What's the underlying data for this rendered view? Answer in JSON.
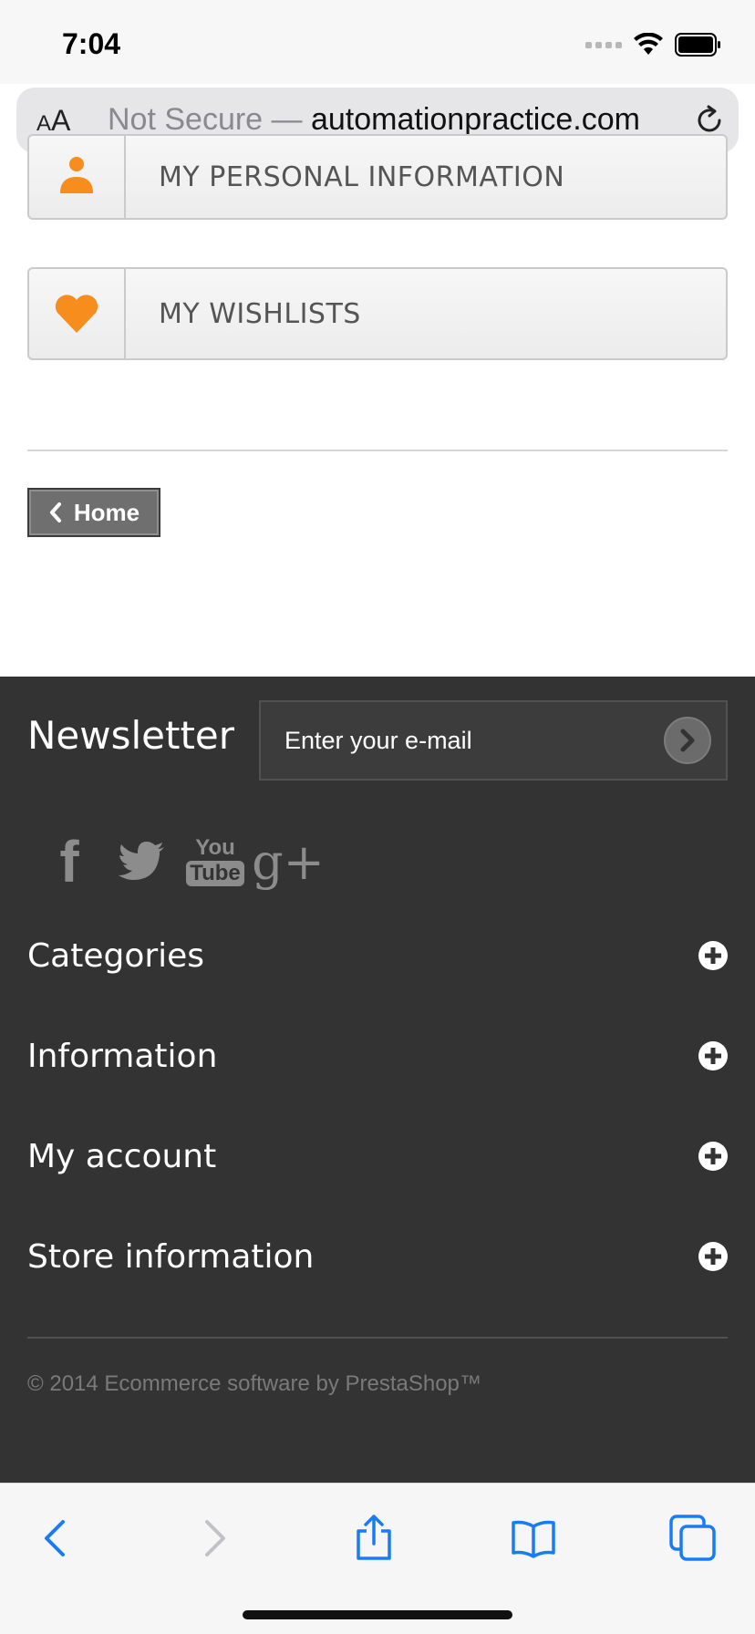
{
  "status_bar": {
    "time": "7:04",
    "icons": [
      "cellular-signal-icon",
      "wifi-icon",
      "battery-icon"
    ]
  },
  "safari": {
    "text_size_label_small": "A",
    "text_size_label_big": "A",
    "security_label": "Not Secure — ",
    "domain": "automationpractice.com",
    "reload_icon": "reload-icon"
  },
  "account_links": {
    "personal_info": {
      "label": "MY PERSONAL INFORMATION",
      "icon": "user-icon"
    },
    "wishlists": {
      "label": "MY WISHLISTS",
      "icon": "heart-icon"
    }
  },
  "home_button": {
    "label": "Home",
    "icon": "chevron-left-icon"
  },
  "footer": {
    "newsletter": {
      "title": "Newsletter",
      "placeholder": "Enter your e-mail",
      "submit_icon": "chevron-right-icon"
    },
    "social": [
      {
        "name": "facebook",
        "glyph": "f"
      },
      {
        "name": "twitter",
        "glyph": ""
      },
      {
        "name": "youtube",
        "glyph_top": "You",
        "glyph_bottom": "Tube"
      },
      {
        "name": "google-plus",
        "glyph": "g+"
      }
    ],
    "sections": [
      {
        "title": "Categories"
      },
      {
        "title": "Information"
      },
      {
        "title": "My account"
      },
      {
        "title": "Store information"
      }
    ],
    "copyright": "© 2014 Ecommerce software by PrestaShop™"
  },
  "toolbar": {
    "buttons": [
      "back-icon",
      "forward-icon",
      "share-icon",
      "bookmarks-icon",
      "tabs-icon"
    ]
  },
  "colors": {
    "accent_orange": "#f78d1d",
    "footer_bg": "#333333",
    "safari_blue": "#1a7cf5"
  }
}
